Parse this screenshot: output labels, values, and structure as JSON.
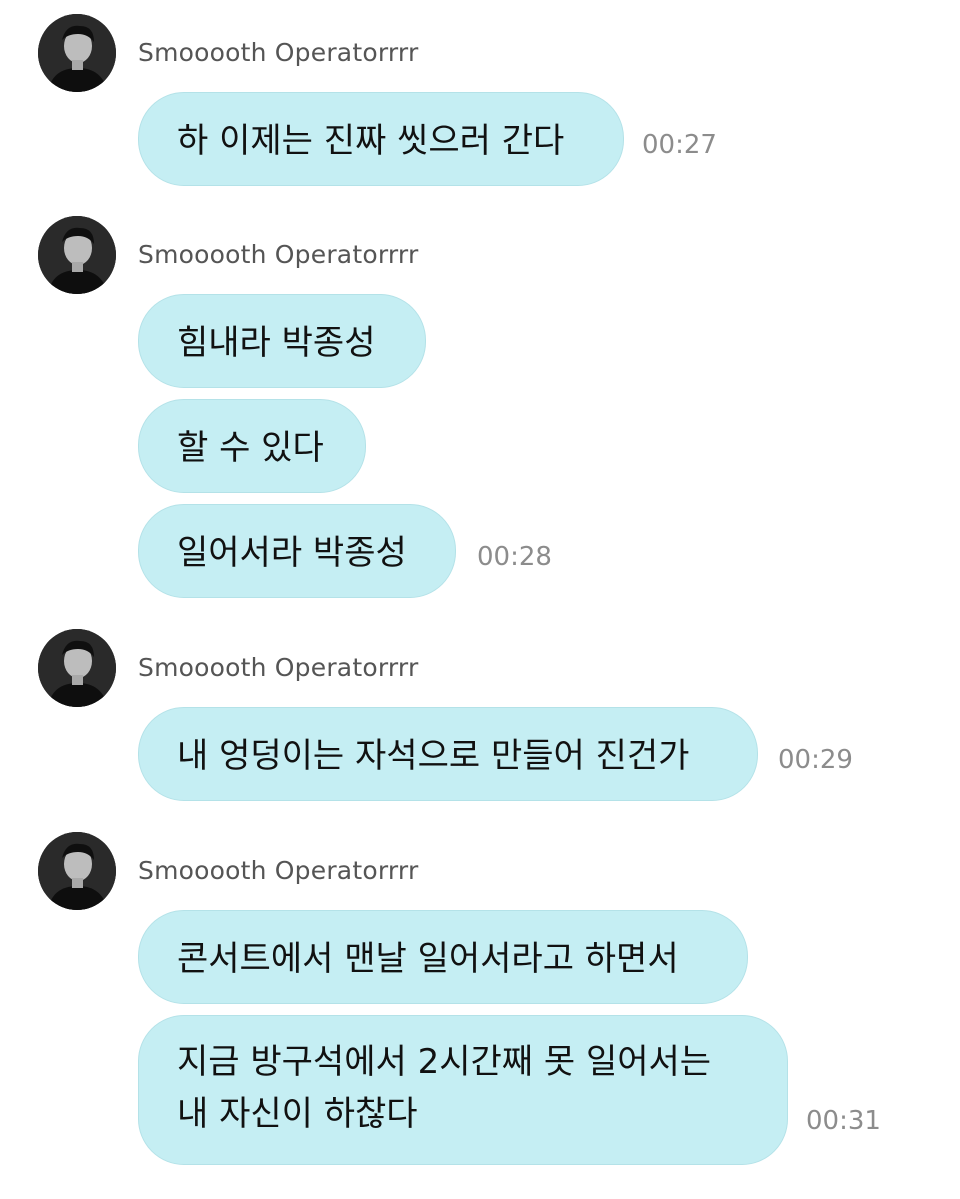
{
  "sender_name": "Smooooth Operatorrrr",
  "avatar_icon": "person-portrait-icon",
  "colors": {
    "bubble": "#c5eef3",
    "sender_text": "#555555",
    "timestamp_text": "#8c8c8c"
  },
  "groups": [
    {
      "sender": "Smooooth Operatorrrr",
      "messages": [
        {
          "text": "하 이제는 진짜 씻으러 간다",
          "time": "00:27"
        }
      ]
    },
    {
      "sender": "Smooooth Operatorrrr",
      "messages": [
        {
          "text": "힘내라 박종성"
        },
        {
          "text": "할 수 있다"
        },
        {
          "text": "일어서라 박종성",
          "time": "00:28"
        }
      ]
    },
    {
      "sender": "Smooooth Operatorrrr",
      "messages": [
        {
          "text": "내 엉덩이는 자석으로 만들어 진건가",
          "time": "00:29"
        }
      ]
    },
    {
      "sender": "Smooooth Operatorrrr",
      "messages": [
        {
          "text": "콘서트에서 맨날 일어서라고 하면서"
        },
        {
          "lines": [
            "지금 방구석에서 2시간째 못 일어서는",
            "내 자신이 하찮다"
          ],
          "time": "00:31"
        }
      ]
    }
  ]
}
